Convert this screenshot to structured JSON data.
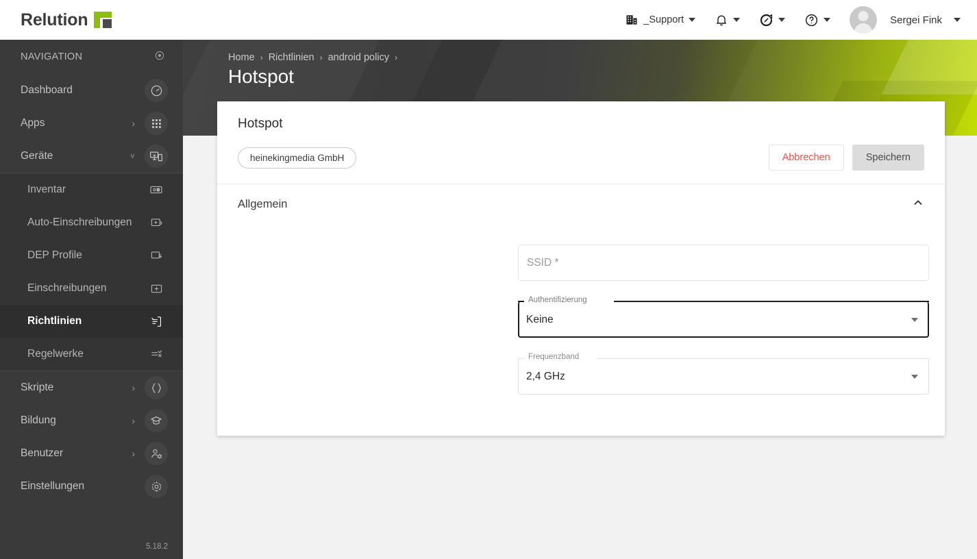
{
  "brand": {
    "name": "Relution",
    "logo_icon": "relution-logo-icon"
  },
  "topbar": {
    "items": [
      {
        "label": "_Support",
        "icon": "organization-building-icon",
        "has_caret": true
      },
      {
        "label": "",
        "icon": "notifications-bell-icon",
        "has_caret": true
      },
      {
        "label": "",
        "icon": "feedback-chat-icon",
        "has_caret": true
      },
      {
        "label": "",
        "icon": "help-question-icon",
        "has_caret": true
      }
    ],
    "user": {
      "name": "Sergei Fink",
      "avatar_icon": "user-avatar-icon",
      "has_caret": true
    }
  },
  "sidebar": {
    "heading": "NAVIGATION",
    "heading_icon": "target-dot-icon",
    "version": "5.18.2",
    "items": [
      {
        "label": "Dashboard",
        "icon": "speedometer-icon",
        "level": 1,
        "expandable": false,
        "expanded": false,
        "active": false
      },
      {
        "label": "Apps",
        "icon": "apps-grid-icon",
        "level": 1,
        "expandable": true,
        "expanded": false,
        "active": false
      },
      {
        "label": "Geräte",
        "icon": "devices-icon",
        "level": 1,
        "expandable": true,
        "expanded": true,
        "active": false
      },
      {
        "label": "Inventar",
        "icon": "inventory-device-icon",
        "level": 2,
        "expandable": false,
        "expanded": false,
        "active": false
      },
      {
        "label": "Auto-Einschreibungen",
        "icon": "auto-enroll-icon",
        "level": 2,
        "expandable": false,
        "expanded": false,
        "active": false
      },
      {
        "label": "DEP Profile",
        "icon": "dep-download-icon",
        "level": 2,
        "expandable": false,
        "expanded": false,
        "active": false
      },
      {
        "label": "Einschreibungen",
        "icon": "enroll-plus-icon",
        "level": 2,
        "expandable": false,
        "expanded": false,
        "active": false
      },
      {
        "label": "Richtlinien",
        "icon": "policy-document-icon",
        "level": 2,
        "expandable": false,
        "expanded": false,
        "active": true
      },
      {
        "label": "Regelwerke",
        "icon": "rules-checklist-icon",
        "level": 2,
        "expandable": false,
        "expanded": false,
        "active": false
      },
      {
        "label": "Skripte",
        "icon": "code-braces-icon",
        "level": 1,
        "expandable": true,
        "expanded": false,
        "active": false
      },
      {
        "label": "Bildung",
        "icon": "graduation-cap-icon",
        "level": 1,
        "expandable": true,
        "expanded": false,
        "active": false
      },
      {
        "label": "Benutzer",
        "icon": "user-settings-icon",
        "level": 1,
        "expandable": true,
        "expanded": false,
        "active": false
      },
      {
        "label": "Einstellungen",
        "icon": "gear-icon",
        "level": 1,
        "expandable": false,
        "expanded": false,
        "active": false
      }
    ]
  },
  "page": {
    "breadcrumb": [
      "Home",
      "Richtlinien",
      "android policy"
    ],
    "breadcrumb_separator": "›",
    "title": "Hotspot"
  },
  "card": {
    "title": "Hotspot",
    "chip": "heinekingmedia GmbH",
    "cancel_label": "Abbrechen",
    "save_label": "Speichern",
    "section": {
      "title": "Allgemein",
      "collapse_icon": "chevron-up-icon",
      "expanded": true
    },
    "fields": [
      {
        "name": "ssid",
        "label": "",
        "placeholder": "SSID *",
        "value": "",
        "type": "text",
        "focused": false
      },
      {
        "name": "authentifizierung",
        "label": "Authentifizierung",
        "placeholder": "",
        "value": "Keine",
        "type": "select",
        "focused": true
      },
      {
        "name": "frequenzband",
        "label": "Frequenzband",
        "placeholder": "",
        "value": "2,4 GHz",
        "type": "select",
        "focused": false
      }
    ]
  },
  "colors": {
    "brand_green": "#8cbe0e",
    "sidebar_bg": "#3a3a3a",
    "sidebar_sub_bg": "#343434",
    "sidebar_active_bg": "#2e2e2e",
    "cancel_red": "#f0504a",
    "save_bg": "#dcdcdc",
    "page_bg": "#f2f2f2"
  }
}
